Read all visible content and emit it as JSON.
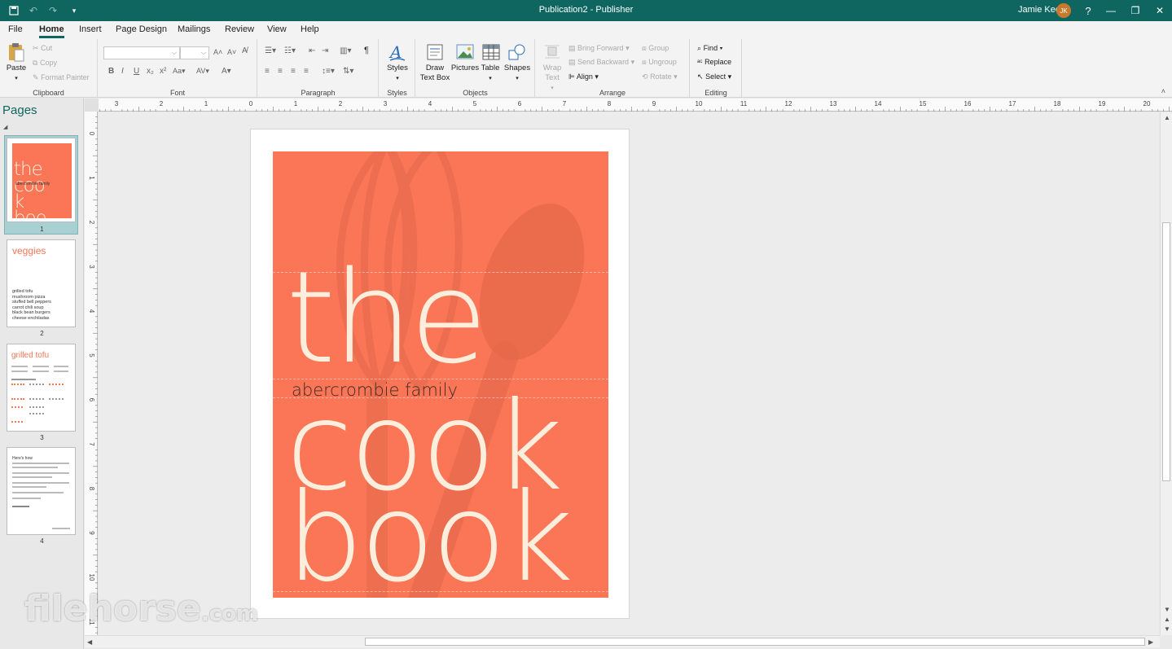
{
  "window": {
    "title": "Publication2  -  Publisher",
    "user_name": "Jamie Keet",
    "user_initials": "JK",
    "help": "?"
  },
  "tabs": [
    "File",
    "Home",
    "Insert",
    "Page Design",
    "Mailings",
    "Review",
    "View",
    "Help"
  ],
  "active_tab": "Home",
  "ribbon": {
    "clipboard": {
      "label": "Clipboard",
      "paste": "Paste",
      "cut": "Cut",
      "copy": "Copy",
      "format_painter": "Format Painter"
    },
    "font": {
      "label": "Font"
    },
    "paragraph": {
      "label": "Paragraph"
    },
    "styles": {
      "label": "Styles",
      "styles_btn": "Styles"
    },
    "objects": {
      "label": "Objects",
      "draw_text_box": "Draw Text Box",
      "pictures": "Pictures",
      "table": "Table",
      "shapes": "Shapes"
    },
    "arrange": {
      "label": "Arrange",
      "wrap_text": "Wrap Text",
      "bring_forward": "Bring Forward",
      "send_backward": "Send Backward",
      "align": "Align",
      "group": "Group",
      "ungroup": "Ungroup",
      "rotate": "Rotate"
    },
    "editing": {
      "label": "Editing",
      "find": "Find",
      "replace": "Replace",
      "select": "Select"
    }
  },
  "pages_pane": {
    "title": "Pages",
    "pages": [
      {
        "number": "1",
        "title": "the cook book",
        "subtitle": "abercrombie family"
      },
      {
        "number": "2",
        "title": "veggies",
        "items": [
          "grilled tofu",
          "mushroom pizza",
          "stuffed bell peppers",
          "carrot chili soup",
          "black bean burgers",
          "cheese enchiladas"
        ]
      },
      {
        "number": "3",
        "title": "grilled tofu"
      },
      {
        "number": "4",
        "title": "Here's how"
      }
    ]
  },
  "ruler_labels": [
    "3",
    "2",
    "1",
    "0",
    "1",
    "2",
    "3",
    "4",
    "5",
    "6",
    "7",
    "8",
    "9",
    "10",
    "11",
    "12",
    "13",
    "14",
    "15",
    "16",
    "17",
    "18",
    "19",
    "20"
  ],
  "vruler_labels": [
    "0",
    "1",
    "2",
    "3",
    "4",
    "5",
    "6",
    "7",
    "8",
    "9",
    "10",
    "11"
  ],
  "cover": {
    "word_the": "the",
    "family": "abercrombie family",
    "word_cook": "cook",
    "word_book": "book",
    "bg_color": "#fa7656",
    "text_color": "#fbeedd"
  },
  "watermark": {
    "main": "filehorse",
    "suffix": ".com"
  }
}
